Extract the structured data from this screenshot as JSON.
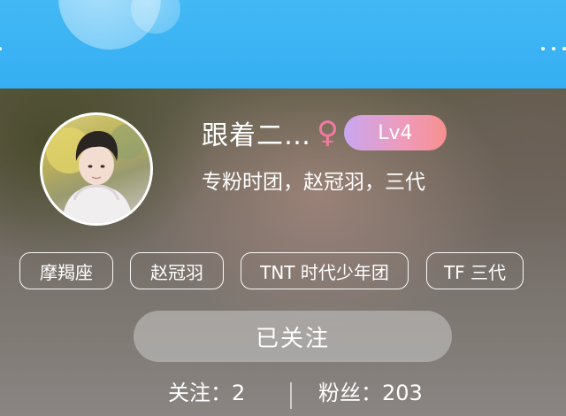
{
  "profile": {
    "nickname": "跟着二…",
    "gender_symbol": "♀",
    "level": "Lv4",
    "bio": "专粉时团，赵冠羽，三代"
  },
  "tags": [
    "摩羯座",
    "赵冠羽",
    "TNT 时代少年团",
    "TF 三代"
  ],
  "follow_button_label": "已关注",
  "stats": {
    "following_label": "关注：",
    "following_count": "2",
    "fans_label": "粉丝：",
    "fans_count": "203"
  },
  "colors": {
    "top_bar": "#3db4f4",
    "gender": "#f27aa0",
    "level_badge_start": "#c8a7f0",
    "level_badge_end": "#f69090"
  },
  "icons": [
    "female-gender-icon",
    "more-dots-icon"
  ]
}
